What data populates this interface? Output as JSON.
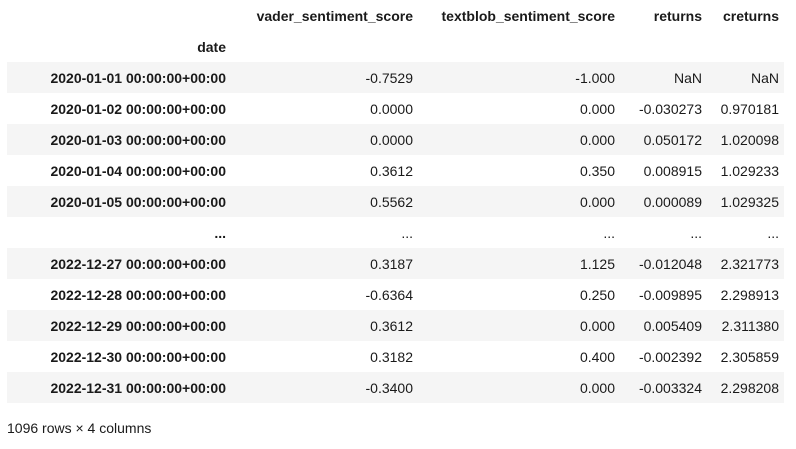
{
  "table": {
    "columns": [
      "vader_sentiment_score",
      "textblob_sentiment_score",
      "returns",
      "creturns"
    ],
    "index_name": "date",
    "rows": [
      {
        "index": "2020-01-01 00:00:00+00:00",
        "vader": "-0.7529",
        "textblob": "-1.000",
        "returns": "NaN",
        "creturns": "NaN"
      },
      {
        "index": "2020-01-02 00:00:00+00:00",
        "vader": "0.0000",
        "textblob": "0.000",
        "returns": "-0.030273",
        "creturns": "0.970181"
      },
      {
        "index": "2020-01-03 00:00:00+00:00",
        "vader": "0.0000",
        "textblob": "0.000",
        "returns": "0.050172",
        "creturns": "1.020098"
      },
      {
        "index": "2020-01-04 00:00:00+00:00",
        "vader": "0.3612",
        "textblob": "0.350",
        "returns": "0.008915",
        "creturns": "1.029233"
      },
      {
        "index": "2020-01-05 00:00:00+00:00",
        "vader": "0.5562",
        "textblob": "0.000",
        "returns": "0.000089",
        "creturns": "1.029325"
      },
      {
        "index": "...",
        "vader": "...",
        "textblob": "...",
        "returns": "...",
        "creturns": "..."
      },
      {
        "index": "2022-12-27 00:00:00+00:00",
        "vader": "0.3187",
        "textblob": "1.125",
        "returns": "-0.012048",
        "creturns": "2.321773"
      },
      {
        "index": "2022-12-28 00:00:00+00:00",
        "vader": "-0.6364",
        "textblob": "0.250",
        "returns": "-0.009895",
        "creturns": "2.298913"
      },
      {
        "index": "2022-12-29 00:00:00+00:00",
        "vader": "0.3612",
        "textblob": "0.000",
        "returns": "0.005409",
        "creturns": "2.311380"
      },
      {
        "index": "2022-12-30 00:00:00+00:00",
        "vader": "0.3182",
        "textblob": "0.400",
        "returns": "-0.002392",
        "creturns": "2.305859"
      },
      {
        "index": "2022-12-31 00:00:00+00:00",
        "vader": "-0.3400",
        "textblob": "0.000",
        "returns": "-0.003324",
        "creturns": "2.298208"
      }
    ]
  },
  "footer": {
    "shape_text": "1096 rows × 4 columns"
  }
}
